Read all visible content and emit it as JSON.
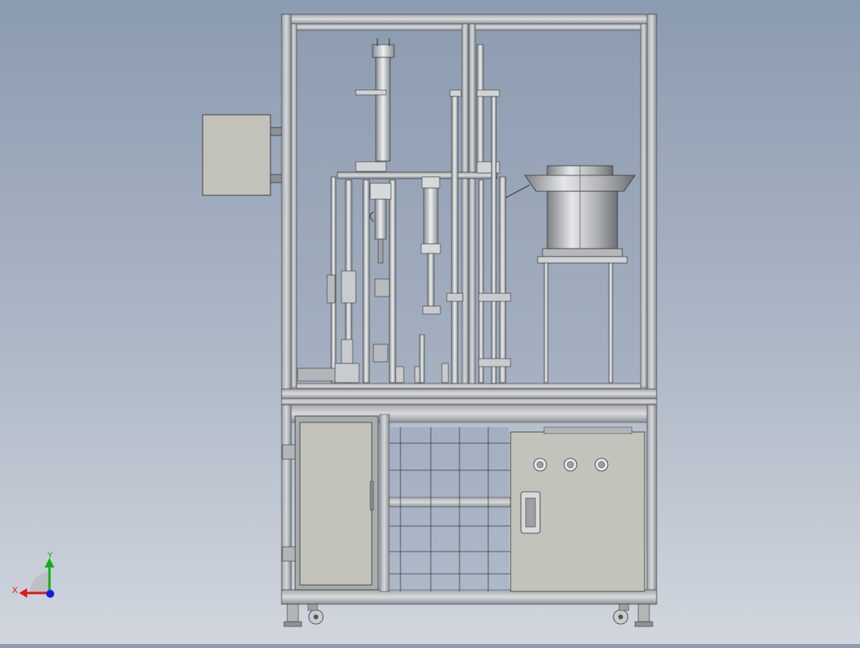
{
  "viewport": {
    "background_top": "#8b9bb0",
    "background_bottom": "#d1d6de"
  },
  "model": {
    "frame_color": "#c8cbcd",
    "frame_dark": "#6f7376",
    "panel_fill": "#c3c3bb",
    "glass_fill": "#8d9cb1",
    "vibratory_feeder_color": "#b5b7b9",
    "control_panel_knobs": 3
  },
  "triad": {
    "x_label": "X",
    "y_label": "Y",
    "x_color": "#e01818",
    "y_color": "#10b010",
    "z_color": "#1818e0"
  }
}
